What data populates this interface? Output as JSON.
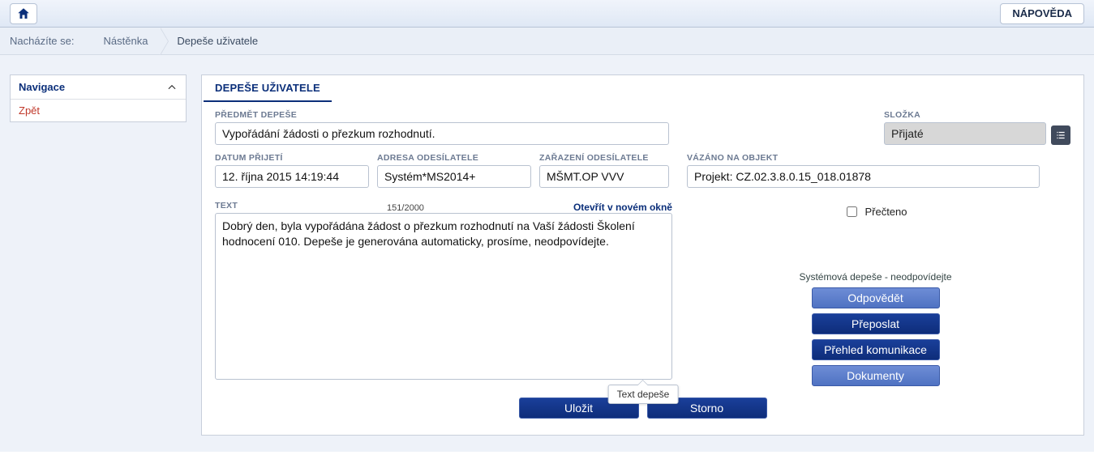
{
  "topbar": {
    "help_label": "NÁPOVĚDA"
  },
  "breadcrumb": {
    "label": "Nacházíte se:",
    "items": [
      "Nástěnka",
      "Depeše uživatele"
    ]
  },
  "sidebar": {
    "nav_title": "Navigace",
    "back_label": "Zpět"
  },
  "panel": {
    "title": "DEPEŠE UŽIVATELE",
    "labels": {
      "subject": "PŘEDMĚT DEPEŠE",
      "folder": "SLOŽKA",
      "received": "DATUM PŘIJETÍ",
      "sender": "ADRESA ODESÍLATELE",
      "sender_class": "ZAŘAZENÍ ODESÍLATELE",
      "bound_object": "VÁZÁNO NA OBJEKT",
      "text": "TEXT",
      "read": "Přečteno"
    },
    "values": {
      "subject": "Vypořádání žádosti o přezkum rozhodnutí.",
      "folder": "Přijaté",
      "received": "12. října 2015 14:19:44",
      "sender": "Systém*MS2014+",
      "sender_class": "MŠMT.OP VVV",
      "bound_object": "Projekt: CZ.02.3.8.0.15_018.01878",
      "text_counter": "151/2000",
      "open_new_window": "Otevřít v novém okně",
      "text": "Dobrý den, byla vypořádána žádost o přezkum rozhodnutí na Vaší žádosti Školení hodnocení 010. Depeše je generována automaticky, prosíme, neodpovídejte."
    },
    "actions_note": "Systémová depeše - neodpovídejte",
    "actions": {
      "reply": "Odpovědět",
      "forward": "Přeposlat",
      "comm_overview": "Přehled komunikace",
      "documents": "Dokumenty"
    },
    "bottom": {
      "save": "Uložit",
      "cancel": "Storno"
    },
    "tooltip": "Text depeše"
  }
}
